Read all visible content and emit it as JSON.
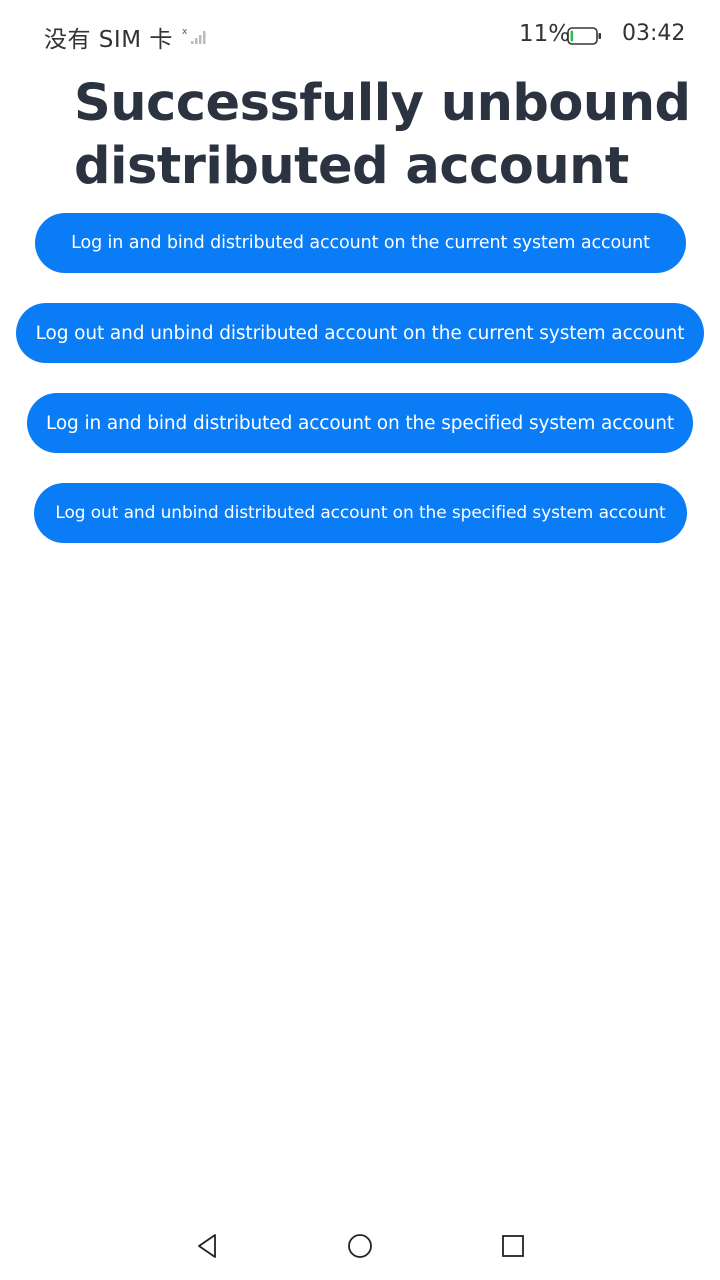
{
  "status_bar": {
    "sim_status": "没有 SIM 卡",
    "battery_percent": "11%",
    "battery_level": 0.11,
    "time": "03:42"
  },
  "title": "Successfully unbound distributed account",
  "buttons": [
    {
      "label": "Log in and bind distributed account on the current system account"
    },
    {
      "label": "Log out and unbind distributed account on the current system account"
    },
    {
      "label": "Log in and bind distributed account on the specified system account"
    },
    {
      "label": "Log out and unbind distributed account on the specified system account"
    }
  ],
  "nav_bar": {
    "back_icon": "triangle-back-icon",
    "home_icon": "circle-home-icon",
    "recent_icon": "square-recent-icon"
  },
  "colors": {
    "accent": "#0a7cf6",
    "title_text": "#2b3240",
    "battery_low": "#2fbf4a"
  }
}
